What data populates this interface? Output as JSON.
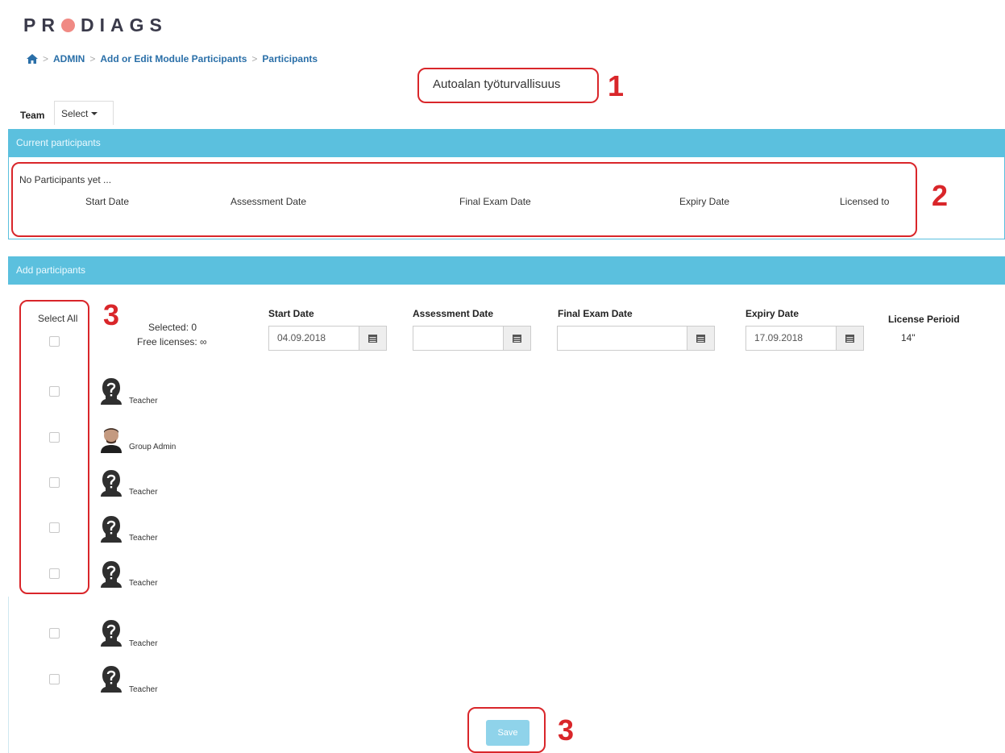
{
  "brand": {
    "logo_left": "PR",
    "logo_right": "DIAGS",
    "accent": "#f08a84"
  },
  "breadcrumb": [
    "ADMIN",
    "Add or Edit Module Participants",
    "Participants"
  ],
  "module_title": "Autoalan työturvallisuus",
  "annotations": [
    "1",
    "2",
    "3",
    "3"
  ],
  "team": {
    "label": "Team",
    "select_label": "Select"
  },
  "current_participants": {
    "header": "Current participants",
    "empty_text": "No Participants yet ...",
    "columns": [
      "Start Date",
      "Assessment Date",
      "Final Exam Date",
      "Expiry Date",
      "Licensed to"
    ]
  },
  "add_participants": {
    "header": "Add participants",
    "select_all": "Select All",
    "selected_text": "Selected: 0",
    "free_licenses": "Free licenses: ∞",
    "columns": {
      "start_date": "Start Date",
      "assessment_date": "Assessment Date",
      "final_exam_date": "Final Exam Date",
      "expiry_date": "Expiry Date",
      "license_period": "License Perioid"
    },
    "values": {
      "start_date": "04.09.2018",
      "assessment_date": "",
      "final_exam_date": "",
      "expiry_date": "17.09.2018",
      "license_period": "14\""
    },
    "users": [
      {
        "role": "Teacher",
        "avatar": "unknown"
      },
      {
        "role": "Group Admin",
        "avatar": "photo"
      },
      {
        "role": "Teacher",
        "avatar": "unknown"
      },
      {
        "role": "Teacher",
        "avatar": "unknown"
      },
      {
        "role": "Teacher",
        "avatar": "unknown"
      },
      {
        "role": "Teacher",
        "avatar": "unknown"
      },
      {
        "role": "Teacher",
        "avatar": "unknown"
      }
    ]
  },
  "save_label": "Save",
  "colors": {
    "header_bar": "#5bc0de",
    "annotation": "#d9262a",
    "link": "#2a6fa8"
  }
}
